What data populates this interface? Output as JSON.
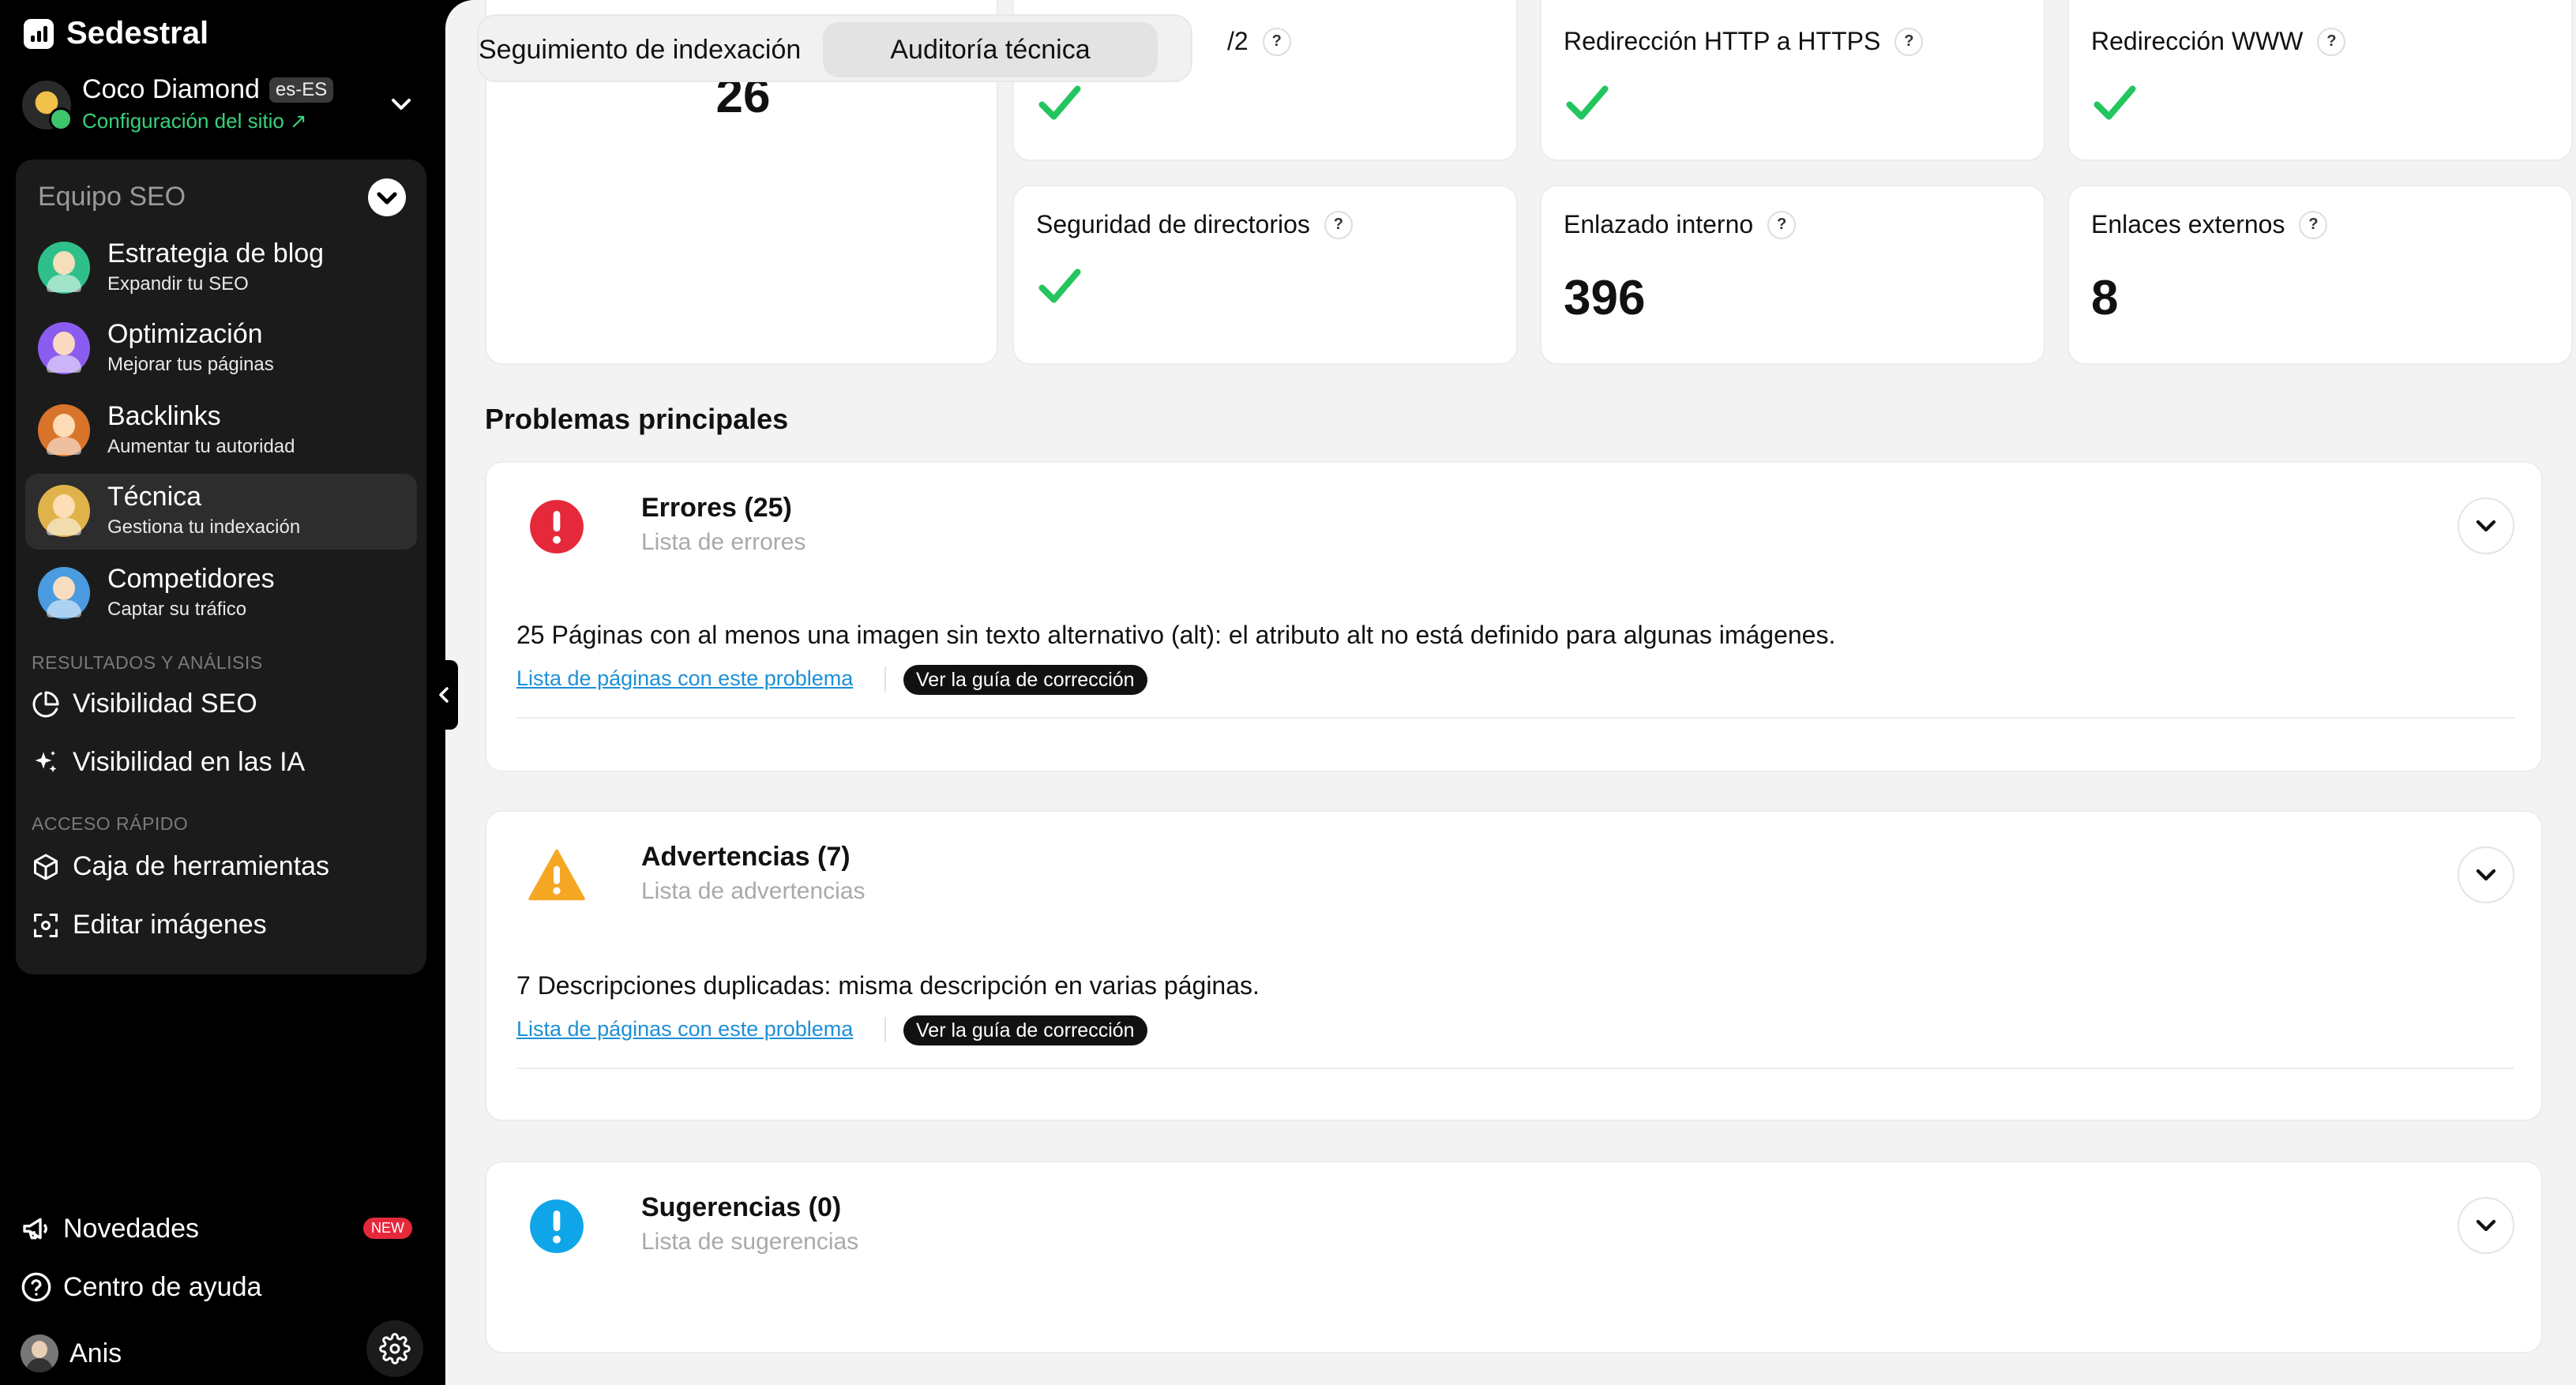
{
  "brand": {
    "name": "Sedestral"
  },
  "site": {
    "name": "Coco Diamond",
    "lang": "es-ES",
    "config_link": "Configuración del sitio ↗"
  },
  "team": {
    "title": "Equipo SEO",
    "agents": [
      {
        "name": "Estrategia de blog",
        "sub": "Expandir tu SEO",
        "color": "#2fbf8a"
      },
      {
        "name": "Optimización",
        "sub": "Mejorar tus páginas",
        "color": "#8a5cf0"
      },
      {
        "name": "Backlinks",
        "sub": "Aumentar tu autoridad",
        "color": "#d9742b"
      },
      {
        "name": "Técnica",
        "sub": "Gestiona tu indexación",
        "color": "#e0b24a"
      },
      {
        "name": "Competidores",
        "sub": "Captar su tráfico",
        "color": "#4a9be0"
      }
    ],
    "results_label": "RESULTADOS Y ANÁLISIS",
    "results": [
      {
        "label": "Visibilidad SEO",
        "icon": "pie-chart-icon"
      },
      {
        "label": "Visibilidad en las IA",
        "icon": "sparkles-icon"
      }
    ],
    "quick_label": "ACCESO RÁPIDO",
    "quick": [
      {
        "label": "Caja de herramientas",
        "icon": "box-icon"
      },
      {
        "label": "Editar imágenes",
        "icon": "image-edit-icon"
      }
    ]
  },
  "bottom": {
    "news": "Novedades",
    "news_badge": "NEW",
    "help": "Centro de ayuda",
    "user": "Anis"
  },
  "tabs": [
    {
      "label": "Seguimiento de indexación",
      "active": false
    },
    {
      "label": "Auditoría técnica",
      "active": true
    }
  ],
  "metrics": [
    {
      "label": "",
      "value": "26"
    },
    {
      "label": "/2",
      "value": null
    },
    {
      "label": "Redirección HTTP a HTTPS",
      "value": null
    },
    {
      "label": "Redirección WWW",
      "value": null
    },
    {
      "label": "Seguridad de directorios",
      "value": null
    },
    {
      "label": "Enlazado interno",
      "value": "396"
    },
    {
      "label": "Enlaces externos",
      "value": "8"
    }
  ],
  "help_mark": "?",
  "problems": {
    "title": "Problemas principales",
    "groups": [
      {
        "title": "Errores (25)",
        "sub": "Lista de errores",
        "color": "#e5293b",
        "issue": "25 Páginas con al menos una imagen sin texto alternativo (alt): el atributo alt no está definido para algunas imágenes.",
        "link": "Lista de páginas con este problema",
        "guide": "Ver la guía de corrección"
      },
      {
        "title": "Advertencias (7)",
        "sub": "Lista de advertencias",
        "color": "#f5a623",
        "issue": "7 Descripciones duplicadas: misma descripción en varias páginas.",
        "link": "Lista de páginas con este problema",
        "guide": "Ver la guía de corrección"
      },
      {
        "title": "Sugerencias (0)",
        "sub": "Lista de sugerencias",
        "color": "#0ea5e9"
      }
    ]
  },
  "colors": {
    "check": "#22c55e",
    "link": "#1d8fd6",
    "accent_green": "#38d27a"
  }
}
